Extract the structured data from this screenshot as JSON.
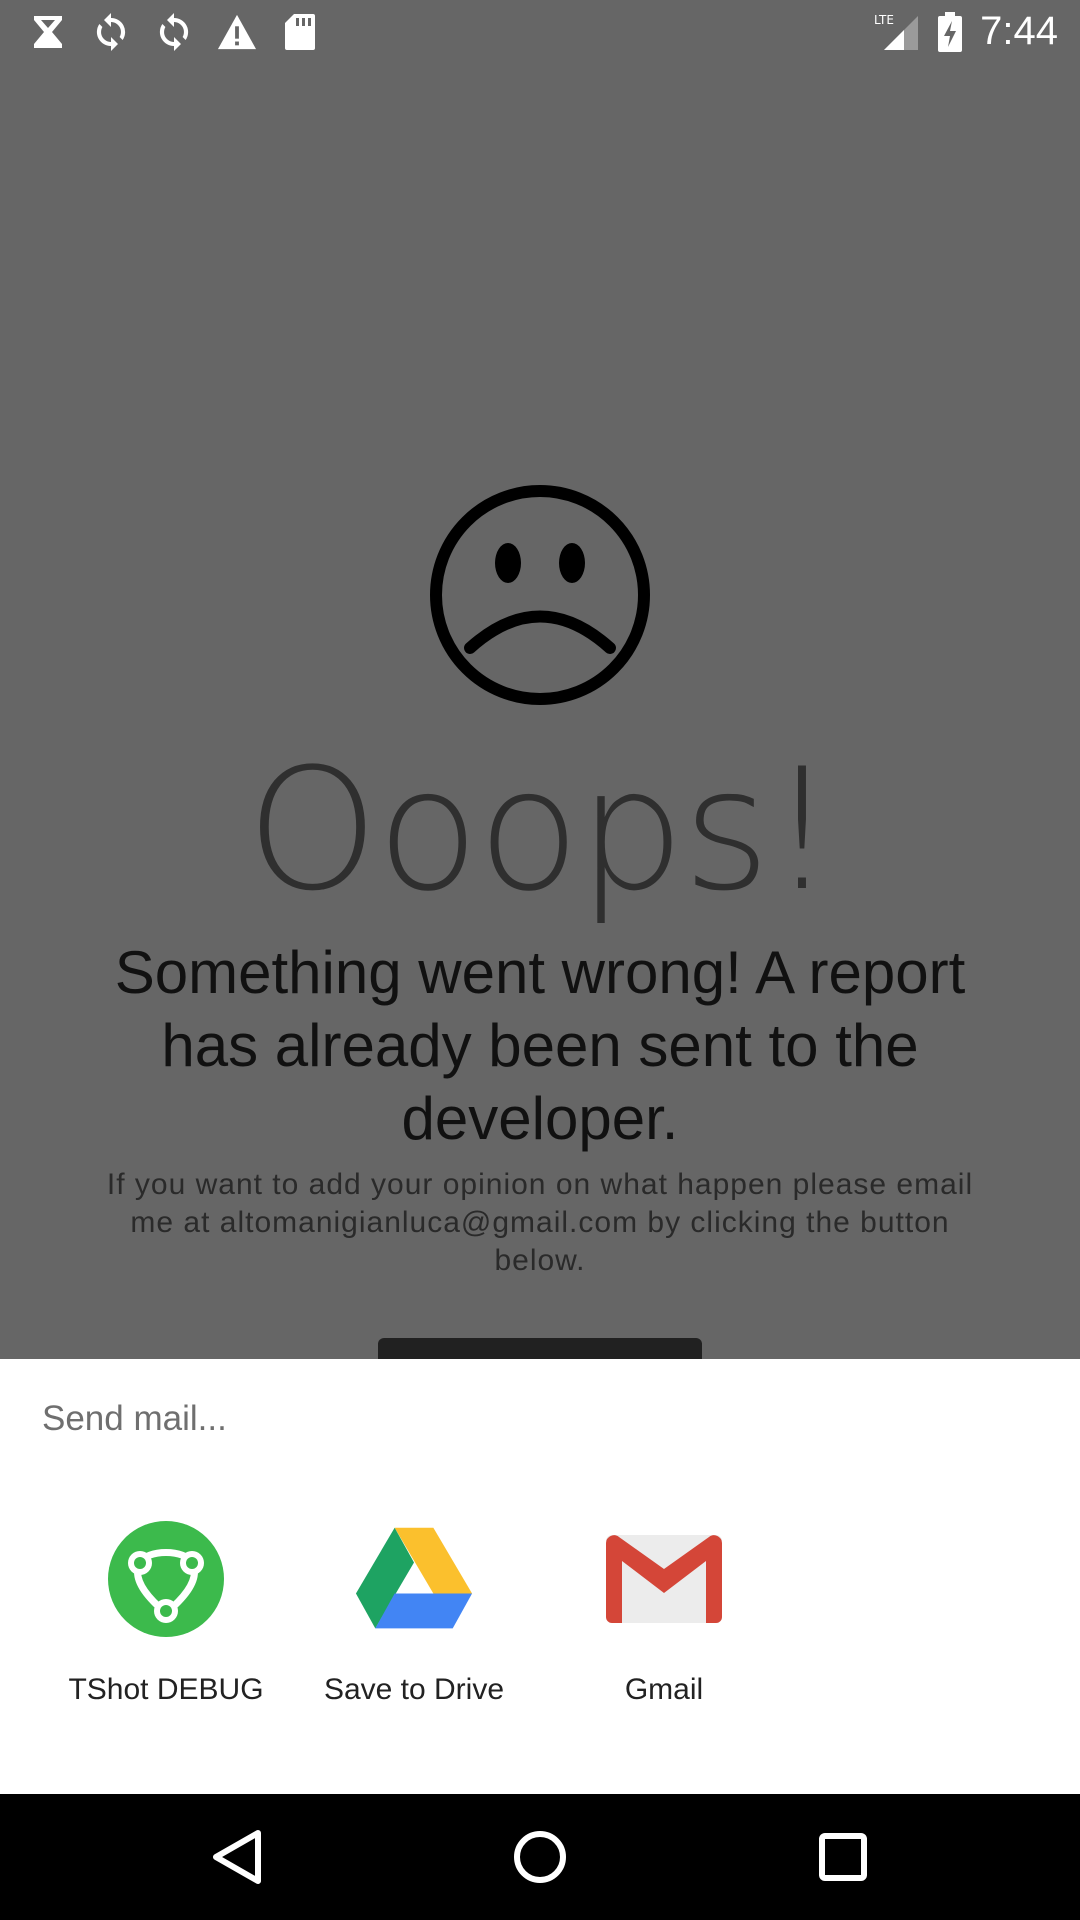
{
  "status_bar": {
    "time": "7:44",
    "network": "LTE",
    "left_icons": [
      "hourglass-icon",
      "sync-icon",
      "sync-icon",
      "warning-icon",
      "sd-card-icon"
    ],
    "right_icons": [
      "lte-signal-icon",
      "battery-charging-icon"
    ]
  },
  "crash_screen": {
    "face_icon": "sad-face-icon",
    "title": "Ooops!",
    "headline": "Something went wrong! A report has already been sent to the developer.",
    "subtext": "If you want to add your opinion on what happen please email me at altomanigianluca@gmail.com by clicking the button below."
  },
  "share_sheet": {
    "title": "Send mail...",
    "targets": [
      {
        "label": "TShot DEBUG",
        "icon": "tshot-debug-icon",
        "color": "#3cba4c"
      },
      {
        "label": "Save to Drive",
        "icon": "google-drive-icon"
      },
      {
        "label": "Gmail",
        "icon": "gmail-icon",
        "color": "#d44638"
      }
    ]
  },
  "nav_bar": {
    "buttons": [
      "back-icon",
      "home-icon",
      "recents-icon"
    ]
  }
}
